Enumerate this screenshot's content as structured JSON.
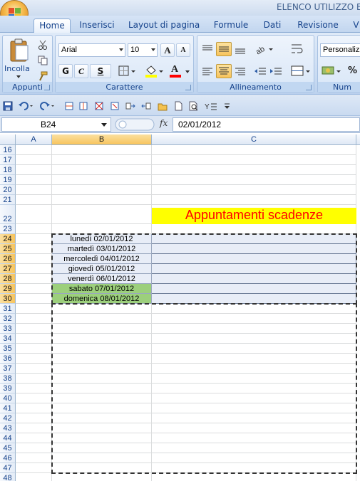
{
  "window": {
    "title": "ELENCO UTILIZZO EX"
  },
  "tabs": [
    {
      "label": "Home",
      "active": true
    },
    {
      "label": "Inserisci"
    },
    {
      "label": "Layout di pagina"
    },
    {
      "label": "Formule"
    },
    {
      "label": "Dati"
    },
    {
      "label": "Revisione"
    },
    {
      "label": "V"
    }
  ],
  "ribbon": {
    "clipboard": {
      "paste_label": "Incolla",
      "group_label": "Appunti"
    },
    "font": {
      "name": "Arial",
      "size": "10",
      "bold": "G",
      "italic": "C",
      "underline": "S",
      "group_label": "Carattere",
      "grow": "A",
      "shrink": "A",
      "color_letter": "A"
    },
    "alignment": {
      "group_label": "Allineamento"
    },
    "number": {
      "format": "Personalizz",
      "percent": "%",
      "group_label": "Num"
    }
  },
  "formula_bar": {
    "name_box": "B24",
    "fx": "fx",
    "value": "02/01/2012"
  },
  "columns": [
    {
      "label": "A"
    },
    {
      "label": "B",
      "selected": true
    },
    {
      "label": "C"
    }
  ],
  "rows": [
    "16",
    "17",
    "18",
    "19",
    "20",
    "21",
    "22",
    "23",
    "24",
    "25",
    "26",
    "27",
    "28",
    "29",
    "30",
    "31",
    "32",
    "33",
    "34",
    "35",
    "36",
    "37",
    "38",
    "39",
    "40",
    "41",
    "42",
    "43",
    "44",
    "45",
    "46",
    "47",
    "48"
  ],
  "selected_rows": [
    "24",
    "25",
    "26",
    "27",
    "28",
    "29",
    "30"
  ],
  "sheet": {
    "title": "Appuntamenti scadenze",
    "days": [
      {
        "text": "lunedì 02/01/2012",
        "weekend": false
      },
      {
        "text": "martedì 03/01/2012",
        "weekend": false
      },
      {
        "text": "mercoledì 04/01/2012",
        "weekend": false
      },
      {
        "text": "giovedì 05/01/2012",
        "weekend": false
      },
      {
        "text": "venerdì 06/01/2012",
        "weekend": false
      },
      {
        "text": "sabato 07/01/2012",
        "weekend": true
      },
      {
        "text": "domenica 08/01/2012",
        "weekend": true
      }
    ]
  },
  "colors": {
    "weekday_fill": "#e8edf7",
    "weekend_fill": "#9ccf7c",
    "title_fill": "#ffff00",
    "title_text": "#ff0000"
  }
}
